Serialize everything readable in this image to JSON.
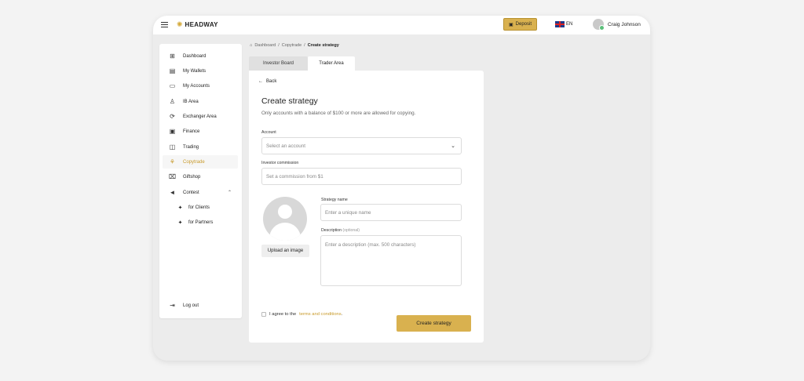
{
  "header": {
    "brand": "HEADWAY",
    "deposit_label": "Deposit",
    "lang": "EN",
    "user_name": "Craig Johnson"
  },
  "sidebar": {
    "items": [
      {
        "label": "Dashboard",
        "icon": "grid-icon"
      },
      {
        "label": "My Wallets",
        "icon": "wallet-icon"
      },
      {
        "label": "My Accounts",
        "icon": "accounts-icon"
      },
      {
        "label": "IB Area",
        "icon": "person-icon"
      },
      {
        "label": "Exchanger Area",
        "icon": "exchange-icon"
      },
      {
        "label": "Finance",
        "icon": "finance-icon"
      },
      {
        "label": "Trading",
        "icon": "chart-icon"
      },
      {
        "label": "Copytrade",
        "icon": "copytrade-icon",
        "active": true
      },
      {
        "label": "Giftshop",
        "icon": "gift-icon"
      },
      {
        "label": "Contest",
        "icon": "megaphone-icon"
      }
    ],
    "sub_items": [
      {
        "label": "for Clients",
        "icon": "sparkle-icon"
      },
      {
        "label": "for Partners",
        "icon": "sparkle-icon"
      }
    ],
    "logout_label": "Log out"
  },
  "breadcrumb": {
    "home": "Dashboard",
    "mid": "Copytrade",
    "current": "Create strategy"
  },
  "tabs": [
    "Investor Board",
    "Trader Area"
  ],
  "form": {
    "back_label": "Back",
    "title": "Create strategy",
    "subtitle": "Only accounts with a balance of $100 or more are allowed for copying.",
    "account_label": "Account",
    "account_placeholder": "Select an account",
    "commission_label": "Investor commission",
    "commission_placeholder": "Set a commission from $1",
    "strategy_name_label": "Strategy name",
    "strategy_name_placeholder": "Enter a unique name",
    "description_label": "Description",
    "description_optional": "(optional)",
    "description_placeholder": "Enter a description (max. 500 characters)",
    "upload_label": "Upload an image",
    "agree_prefix": "I agree to the",
    "agree_link": "terms and conditions",
    "agree_suffix": ".",
    "submit_label": "Create strategy"
  },
  "colors": {
    "accent": "#d9b14f",
    "active_text": "#c89a2a"
  }
}
